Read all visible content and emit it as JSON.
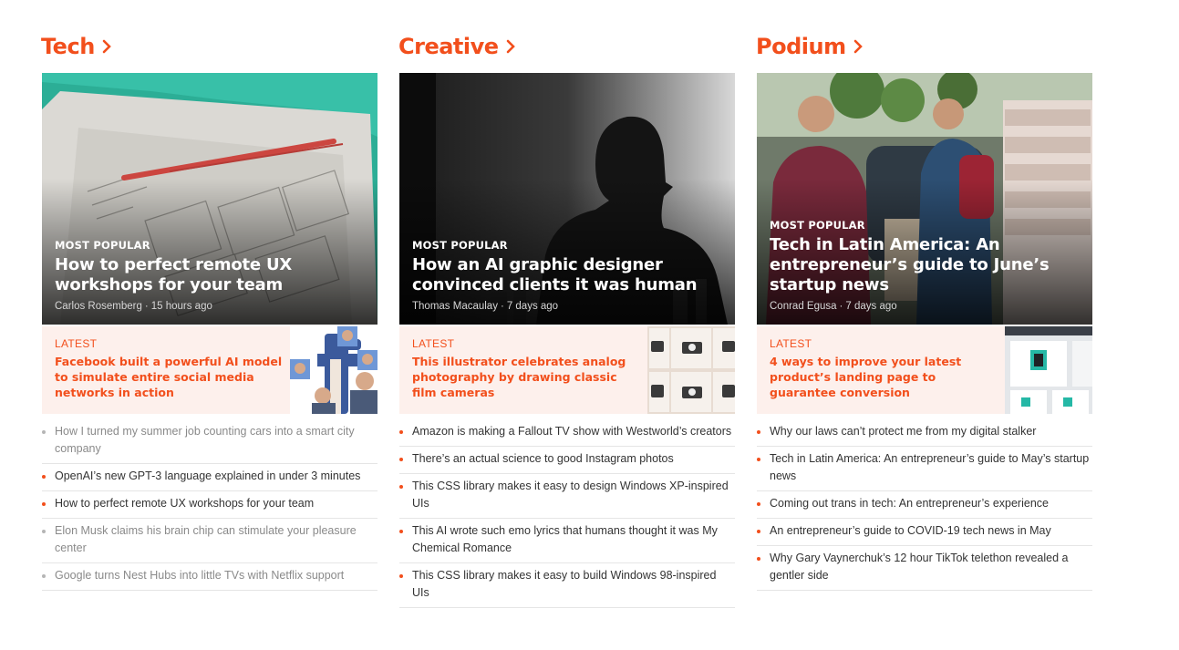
{
  "colors": {
    "accent": "#f24f1c",
    "latest_bg": "#fdf0ec",
    "divider": "#e5e5e5"
  },
  "sections": [
    {
      "title": "Tech",
      "hero": {
        "kicker": "MOST POPULAR",
        "title": "How to perfect remote UX workshops for your team",
        "author": "Carlos Rosemberg",
        "time": "15 hours ago"
      },
      "latest": {
        "label": "LATEST",
        "title": "Facebook built a powerful AI model to simulate entire social media networks in action"
      },
      "links": [
        {
          "text": "How I turned my summer job counting cars into a smart city company",
          "dim": true
        },
        {
          "text": "OpenAI’s new GPT-3 language explained in under 3 minutes",
          "dim": false
        },
        {
          "text": "How to perfect remote UX workshops for your team",
          "dim": false
        },
        {
          "text": "Elon Musk claims his brain chip can stimulate your pleasure center",
          "dim": true
        },
        {
          "text": "Google turns Nest Hubs into little TVs with Netflix support",
          "dim": true
        }
      ]
    },
    {
      "title": "Creative",
      "hero": {
        "kicker": "MOST POPULAR",
        "title": "How an AI graphic designer convinced clients it was human",
        "author": "Thomas Macaulay",
        "time": "7 days ago"
      },
      "latest": {
        "label": "LATEST",
        "title": "This illustrator celebrates analog photography by drawing classic film cameras"
      },
      "links": [
        {
          "text": "Amazon is making a Fallout TV show with Westworld’s creators",
          "dim": false
        },
        {
          "text": "There’s an actual science to good Instagram photos",
          "dim": false
        },
        {
          "text": "This CSS library makes it easy to design Windows XP-inspired UIs",
          "dim": false
        },
        {
          "text": "This AI wrote such emo lyrics that humans thought it was My Chemical Romance",
          "dim": false
        },
        {
          "text": "This CSS library makes it easy to build Windows 98-inspired UIs",
          "dim": false
        }
      ]
    },
    {
      "title": "Podium",
      "hero": {
        "kicker": "MOST POPULAR",
        "title": "Tech in Latin America: An entrepreneur’s guide to June’s startup news",
        "author": "Conrad Egusa",
        "time": "7 days ago"
      },
      "latest": {
        "label": "LATEST",
        "title": "4 ways to improve your latest product’s landing page to guarantee conversion"
      },
      "links": [
        {
          "text": "Why our laws can’t protect me from my digital stalker",
          "dim": false
        },
        {
          "text": "Tech in Latin America: An entrepreneur’s guide to May’s startup news",
          "dim": false
        },
        {
          "text": "Coming out trans in tech: An entrepreneur’s experience",
          "dim": false
        },
        {
          "text": "An entrepreneur’s guide to COVID-19 tech news in May",
          "dim": false
        },
        {
          "text": "Why Gary Vaynerchuk’s 12 hour TikTok telethon revealed a gentler side",
          "dim": false
        }
      ]
    }
  ]
}
